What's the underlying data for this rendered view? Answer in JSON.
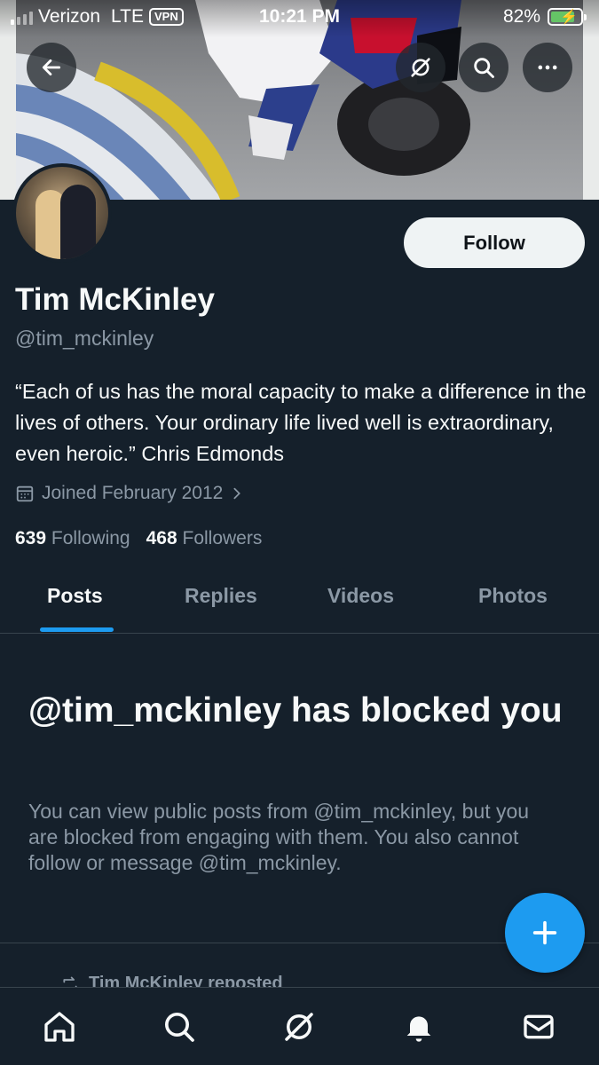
{
  "status_bar": {
    "carrier": "Verizon",
    "network": "LTE",
    "vpn": "VPN",
    "time": "10:21 PM",
    "battery": "82%",
    "battery_level": 0.82
  },
  "header_buttons": {
    "back": "arrow-left-icon",
    "grok": "grok-icon",
    "search": "search-icon",
    "more": "more-horizontal-icon"
  },
  "profile": {
    "name": "Tim McKinley",
    "handle": "@tim_mckinley",
    "bio": "“Each of us has the moral capacity to make a difference in the lives of others. Your ordinary life lived well is extraordinary, even heroic.” Chris Edmonds",
    "joined": "Joined February 2012",
    "following_count": "639",
    "following_label": "Following",
    "followers_count": "468",
    "followers_label": "Followers",
    "follow_label": "Follow"
  },
  "tabs": [
    {
      "label": "Posts",
      "active": true
    },
    {
      "label": "Replies",
      "active": false
    },
    {
      "label": "Videos",
      "active": false
    },
    {
      "label": "Photos",
      "active": false
    }
  ],
  "blocked": {
    "title": "@tim_mckinley has blocked you",
    "body": "You can view public posts from @tim_mckinley, but you are blocked from engaging with them. You also cannot follow or message @tim_mckinley."
  },
  "repost_label": "Tim McKinley reposted",
  "colors": {
    "background": "#15202b",
    "accent": "#1d9bf0",
    "secondary_text": "#8b98a5",
    "primary_text": "#f7f9f9"
  },
  "bottom_nav": [
    "home-icon",
    "search-icon",
    "grok-icon",
    "bell-icon",
    "mail-icon"
  ]
}
